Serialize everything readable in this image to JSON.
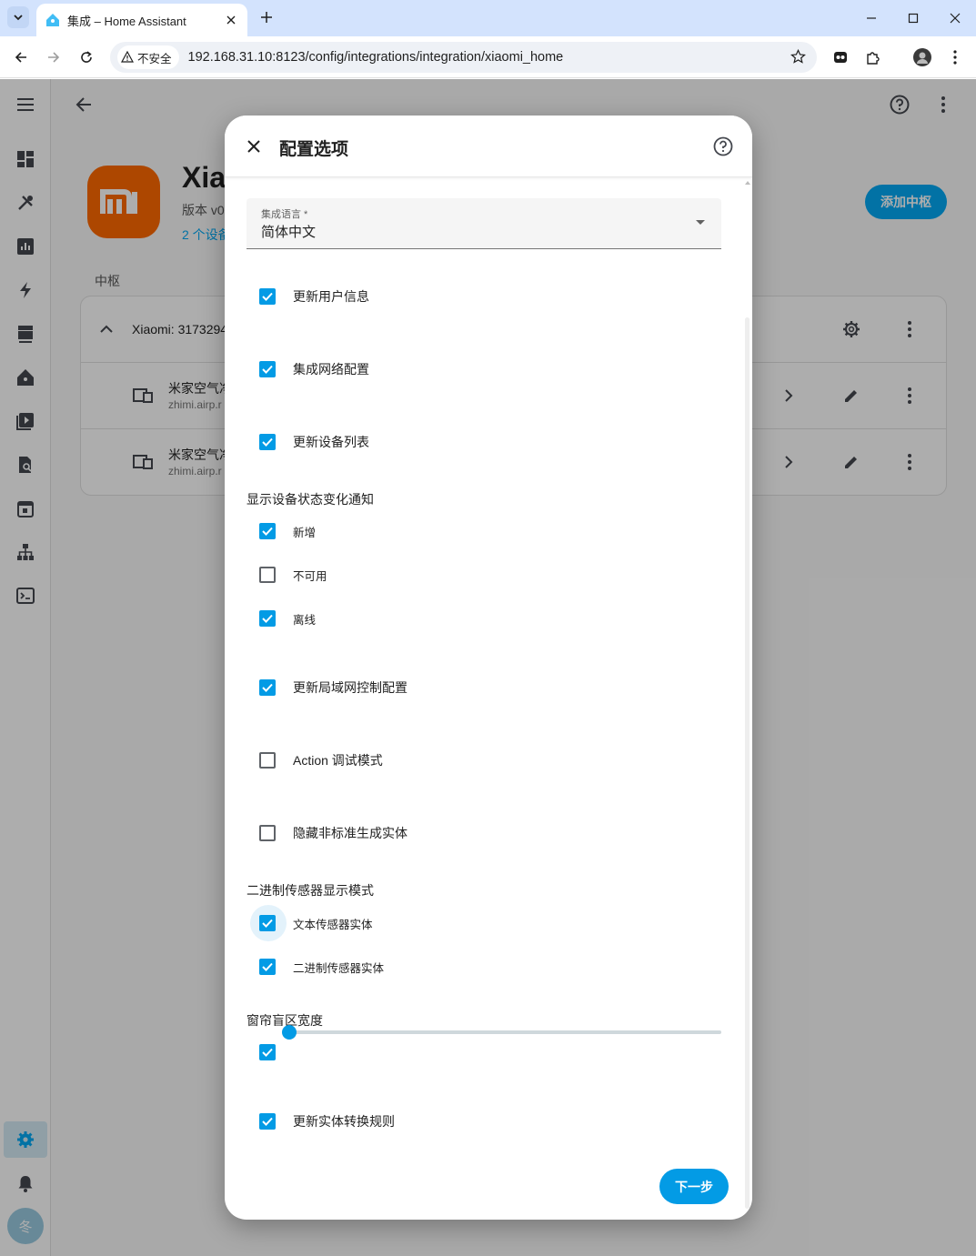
{
  "browser": {
    "tab_title": "集成 – Home Assistant",
    "security_label": "不安全",
    "url": "192.168.31.10:8123/config/integrations/integration/xiaomi_home"
  },
  "integration": {
    "title_partial": "Xia",
    "version_partial": "版本 v0",
    "devices_partial": "2 个设备",
    "add_hub_label": "添加中枢",
    "hub_section_label": "中枢",
    "hub_name_partial": "Xiaomi: 3173294",
    "devices": [
      {
        "name_partial": "米家空气净",
        "model_partial": "zhimi.airp.r"
      },
      {
        "name_partial": "米家空气净",
        "model_partial": "zhimi.airp.r"
      }
    ]
  },
  "user": {
    "avatar_initial": "冬"
  },
  "dialog": {
    "title": "配置选项",
    "language": {
      "label": "集成语言 *",
      "value": "简体中文"
    },
    "options": {
      "update_user_info": {
        "label": "更新用户信息",
        "checked": true
      },
      "network_config": {
        "label": "集成网络配置",
        "checked": true
      },
      "update_device_list": {
        "label": "更新设备列表",
        "checked": true
      }
    },
    "notify_section": {
      "title": "显示设备状态变化通知",
      "items": [
        {
          "label": "新增",
          "checked": true
        },
        {
          "label": "不可用",
          "checked": false
        },
        {
          "label": "离线",
          "checked": true
        }
      ]
    },
    "lan_control": {
      "label": "更新局域网控制配置",
      "checked": true
    },
    "action_debug": {
      "label": "Action 调试模式",
      "checked": false
    },
    "hide_nonstandard": {
      "label": "隐藏非标准生成实体",
      "checked": false
    },
    "binary_sensor_section": {
      "title": "二进制传感器显示模式",
      "items": [
        {
          "label": "文本传感器实体",
          "checked": true
        },
        {
          "label": "二进制传感器实体",
          "checked": true
        }
      ]
    },
    "curtain_section": {
      "title": "窗帘盲区宽度",
      "slider_value_fraction": 0.0,
      "checkbox_checked": true
    },
    "update_trans_rules": {
      "label": "更新实体转换规则",
      "checked": true
    },
    "next_label": "下一步"
  },
  "colors": {
    "primary": "#03a9f4",
    "checkbox": "#039be5",
    "xiaomi_orange": "#ff6900"
  }
}
